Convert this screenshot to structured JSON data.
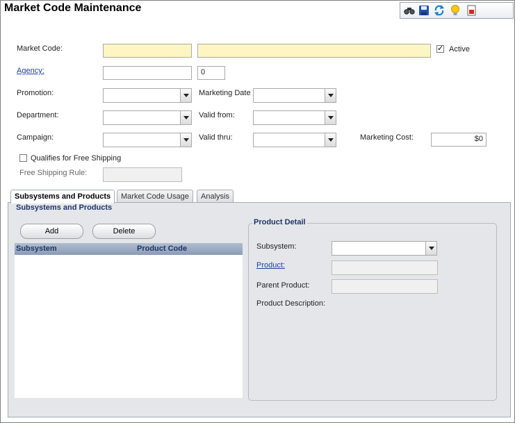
{
  "page": {
    "title": "Market Code Maintenance"
  },
  "toolbar": {
    "icons": [
      "binoculars-icon",
      "save-icon",
      "refresh-icon",
      "lightbulb-icon",
      "report-icon"
    ]
  },
  "form": {
    "market_code_label": "Market Code:",
    "market_code_value": "",
    "market_description_value": "",
    "active_label": "Active",
    "active_checked": true,
    "agency_label": "Agency:",
    "agency_value": "",
    "agency_number": "0",
    "promotion_label": "Promotion:",
    "marketing_date_label": "Marketing Date",
    "department_label": "Department:",
    "valid_from_label": "Valid from:",
    "campaign_label": "Campaign:",
    "valid_thru_label": "Valid thru:",
    "marketing_cost_label": "Marketing Cost:",
    "marketing_cost_value": "$0",
    "free_shipping_label": "Qualifies for Free Shipping",
    "free_shipping_checked": false,
    "free_shipping_rule_label": "Free Shipping Rule:",
    "free_shipping_rule_value": ""
  },
  "tabs": [
    {
      "label": "Subsystems and Products",
      "active": true
    },
    {
      "label": "Market Code Usage",
      "active": false
    },
    {
      "label": "Analysis",
      "active": false
    }
  ],
  "subsystems": {
    "group_title": "Subsystems and Products",
    "add_label": "Add",
    "delete_label": "Delete",
    "columns": [
      "Subsystem",
      "Product Code"
    ],
    "rows": []
  },
  "product_detail": {
    "group_title": "Product Detail",
    "subsystem_label": "Subsystem:",
    "product_label": "Product:",
    "parent_product_label": "Parent Product:",
    "product_description_label": "Product Description:"
  }
}
